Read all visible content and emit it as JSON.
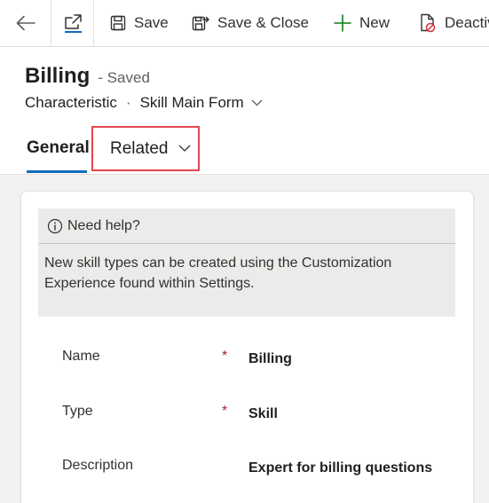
{
  "commandbar": {
    "save_label": "Save",
    "save_close_label": "Save & Close",
    "new_label": "New",
    "deactivate_label": "Deactivate"
  },
  "record": {
    "title": "Billing",
    "save_status": "- Saved",
    "entity": "Characteristic",
    "separator": "·",
    "form": "Skill Main Form"
  },
  "tabs": [
    {
      "label": "General",
      "selected": true
    },
    {
      "label": "Related",
      "selected": false,
      "highlighted": true
    }
  ],
  "help": {
    "title": "Need help?",
    "text": "New skill types can be created using the Customization Experience found within Settings."
  },
  "fields": [
    {
      "label": "Name",
      "required": true,
      "value": "Billing"
    },
    {
      "label": "Type",
      "required": true,
      "value": "Skill"
    },
    {
      "label": "Description",
      "required": false,
      "value": "Expert for billing questions"
    }
  ],
  "required_marker": "*",
  "colors": {
    "accent": "#0f6cbd",
    "highlight_box": "#e3464d",
    "required": "#a4262c",
    "new_icon": "#107c10"
  }
}
